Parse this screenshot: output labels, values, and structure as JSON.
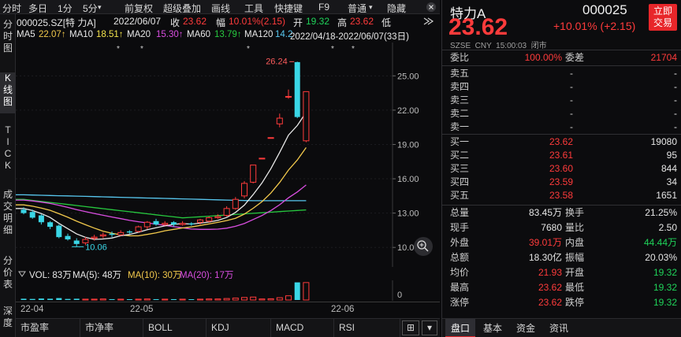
{
  "toolbar": {
    "items": [
      "分时",
      "多日",
      "1分",
      "5分",
      "▾",
      "前复权",
      "超级叠加",
      "画线",
      "工具",
      "快捷键",
      "F9",
      "普通",
      "隐藏"
    ],
    "colors": {
      "bg": "#17171a"
    }
  },
  "leftnav": {
    "items": [
      "分\n时\n图",
      "K\n线\n图",
      "T\nI\nC\nK",
      "成\n交\n明\n细",
      "分\n价\n表",
      "深\n度"
    ]
  },
  "info": {
    "code_name": "000025.SZ[特 力A]",
    "date": "2022/06/07",
    "close_label": "收",
    "close_value": "23.62",
    "change_label": "幅",
    "change_value": "10.01%(2.15)",
    "open_label": "开",
    "open_value": "19.32",
    "high_label": "高",
    "high_value": "23.62",
    "low_label": "低"
  },
  "ma": {
    "ma5_label": "MA5",
    "ma5_value": "22.07↑",
    "ma10_label": "MA10",
    "ma10_value": "18.51↑",
    "ma20_label": "MA20",
    "ma20_value": "15.30↑",
    "ma60_label": "MA60",
    "ma60_value": "13.79↑",
    "ma120_label": "MA120",
    "ma120_value": "14.2",
    "range": "2022/04/18-2022/06/07(33日)",
    "colors": {
      "ma5": "#e8e8e8",
      "ma10": "#f2c94c",
      "ma20": "#d94ee0",
      "ma60": "#27c93f",
      "ma120": "#58c8f0"
    }
  },
  "chart_data": {
    "type": "candlestick",
    "y_ticks": [
      "25.00",
      "22.00",
      "19.00",
      "16.00",
      "13.00",
      "10.00"
    ],
    "ylim": [
      8.5,
      27.5
    ],
    "x_ticks": [
      "22-04",
      "22-05",
      "22-06"
    ],
    "high_label": "26.24",
    "low_label": "10.06",
    "candles": [
      {
        "o": 13.3,
        "c": 13.0,
        "h": 13.5,
        "l": 12.9
      },
      {
        "o": 13.1,
        "c": 12.6,
        "h": 13.3,
        "l": 12.5
      },
      {
        "o": 12.8,
        "c": 12.2,
        "h": 12.9,
        "l": 12.0
      },
      {
        "o": 12.2,
        "c": 11.8,
        "h": 12.3,
        "l": 11.6
      },
      {
        "o": 11.9,
        "c": 10.9,
        "h": 12.0,
        "l": 10.8
      },
      {
        "o": 11.0,
        "c": 10.7,
        "h": 11.2,
        "l": 10.6
      },
      {
        "o": 10.6,
        "c": 10.3,
        "h": 10.8,
        "l": 10.06
      },
      {
        "o": 10.4,
        "c": 10.7,
        "h": 10.9,
        "l": 10.2
      },
      {
        "o": 10.8,
        "c": 10.9,
        "h": 11.1,
        "l": 10.6
      },
      {
        "o": 11.0,
        "c": 11.1,
        "h": 11.3,
        "l": 10.8
      },
      {
        "o": 11.2,
        "c": 11.1,
        "h": 11.4,
        "l": 10.9
      },
      {
        "o": 11.1,
        "c": 11.3,
        "h": 11.5,
        "l": 11.0
      },
      {
        "o": 11.4,
        "c": 11.3,
        "h": 11.5,
        "l": 11.2
      },
      {
        "o": 11.4,
        "c": 11.8,
        "h": 11.9,
        "l": 11.3
      },
      {
        "o": 11.8,
        "c": 12.2,
        "h": 12.3,
        "l": 11.6
      },
      {
        "o": 12.3,
        "c": 12.0,
        "h": 12.5,
        "l": 11.9
      },
      {
        "o": 12.0,
        "c": 12.1,
        "h": 12.3,
        "l": 11.9
      },
      {
        "o": 12.2,
        "c": 12.0,
        "h": 12.3,
        "l": 11.8
      },
      {
        "o": 12.0,
        "c": 12.1,
        "h": 12.3,
        "l": 11.9
      },
      {
        "o": 12.1,
        "c": 12.0,
        "h": 12.2,
        "l": 11.9
      },
      {
        "o": 12.2,
        "c": 12.4,
        "h": 12.5,
        "l": 12.0
      },
      {
        "o": 12.3,
        "c": 12.6,
        "h": 12.7,
        "l": 12.2
      },
      {
        "o": 12.6,
        "c": 12.7,
        "h": 12.9,
        "l": 12.5
      },
      {
        "o": 12.8,
        "c": 13.4,
        "h": 13.6,
        "l": 12.7
      },
      {
        "o": 13.4,
        "c": 14.2,
        "h": 14.4,
        "l": 13.3
      },
      {
        "o": 14.5,
        "c": 15.6,
        "h": 15.8,
        "l": 14.3
      },
      {
        "o": 15.7,
        "c": 17.2,
        "h": 17.2,
        "l": 15.6
      },
      {
        "o": 17.8,
        "c": 17.8,
        "h": 17.8,
        "l": 17.8
      },
      {
        "o": 19.6,
        "c": 19.6,
        "h": 19.6,
        "l": 19.6
      },
      {
        "o": 20.8,
        "c": 21.3,
        "h": 21.7,
        "l": 20.5
      },
      {
        "o": 23.2,
        "c": 23.2,
        "h": 23.8,
        "l": 23.0
      },
      {
        "o": 26.2,
        "c": 21.4,
        "h": 26.24,
        "l": 21.3
      },
      {
        "o": 19.32,
        "c": 23.62,
        "h": 23.62,
        "l": 19.2
      }
    ],
    "volume": {
      "label": "VOL: 83万",
      "ma5": "MA(5): 48万",
      "ma10": "MA(10): 30万",
      "ma20": "MA(20): 17万",
      "zero": "0",
      "values": [
        6,
        5,
        7,
        6,
        9,
        5,
        6,
        4,
        4,
        5,
        4,
        4,
        3,
        4,
        5,
        4,
        4,
        4,
        4,
        3,
        4,
        5,
        5,
        7,
        9,
        12,
        14,
        5,
        6,
        11,
        20,
        84,
        83
      ]
    }
  },
  "indicators": [
    "市盈率",
    "市净率",
    "BOLL",
    "KDJ",
    "MACD",
    "RSI",
    "⊞",
    "▾"
  ],
  "quote": {
    "name": "特力A",
    "code": "000025",
    "price": "23.62",
    "change": "+10.01% (+2.15)",
    "meta": "SZSE  CNY  15:00:03  闭市",
    "trade_btn": "立即\n交易",
    "weibi_label": "委比",
    "weibi_value": "100.00%",
    "weicha_label": "委差",
    "weicha_value": "21704",
    "sells": [
      {
        "label": "卖五",
        "price": "-",
        "vol": "-"
      },
      {
        "label": "卖四",
        "price": "-",
        "vol": "-"
      },
      {
        "label": "卖三",
        "price": "-",
        "vol": "-"
      },
      {
        "label": "卖二",
        "price": "-",
        "vol": "-"
      },
      {
        "label": "卖一",
        "price": "-",
        "vol": "-"
      }
    ],
    "buys": [
      {
        "label": "买一",
        "price": "23.62",
        "vol": "19080"
      },
      {
        "label": "买二",
        "price": "23.61",
        "vol": "95"
      },
      {
        "label": "买三",
        "price": "23.60",
        "vol": "844"
      },
      {
        "label": "买四",
        "price": "23.59",
        "vol": "34"
      },
      {
        "label": "买五",
        "price": "23.58",
        "vol": "1651"
      }
    ],
    "stats": [
      {
        "l1": "总量",
        "v1": "83.45万",
        "c1": "white",
        "l2": "换手",
        "v2": "21.25%",
        "c2": "white"
      },
      {
        "l1": "现手",
        "v1": "7680",
        "c1": "white",
        "l2": "量比",
        "v2": "2.50",
        "c2": "white"
      },
      {
        "l1": "外盘",
        "v1": "39.01万",
        "c1": "red",
        "l2": "内盘",
        "v2": "44.44万",
        "c2": "green"
      },
      {
        "l1": "总额",
        "v1": "18.30亿",
        "c1": "white",
        "l2": "振幅",
        "v2": "20.03%",
        "c2": "white"
      },
      {
        "l1": "均价",
        "v1": "21.93",
        "c1": "red",
        "l2": "开盘",
        "v2": "19.32",
        "c2": "green"
      },
      {
        "l1": "最高",
        "v1": "23.62",
        "c1": "red",
        "l2": "最低",
        "v2": "19.32",
        "c2": "green"
      },
      {
        "l1": "涨停",
        "v1": "23.62",
        "c1": "red",
        "l2": "跌停",
        "v2": "19.32",
        "c2": "green"
      }
    ],
    "tabs": [
      "盘口",
      "基本",
      "资金",
      "资讯"
    ],
    "colors": {
      "up": "#ff3b3b",
      "down": "#1fd35a",
      "trade_btn": "#e8262a"
    }
  }
}
